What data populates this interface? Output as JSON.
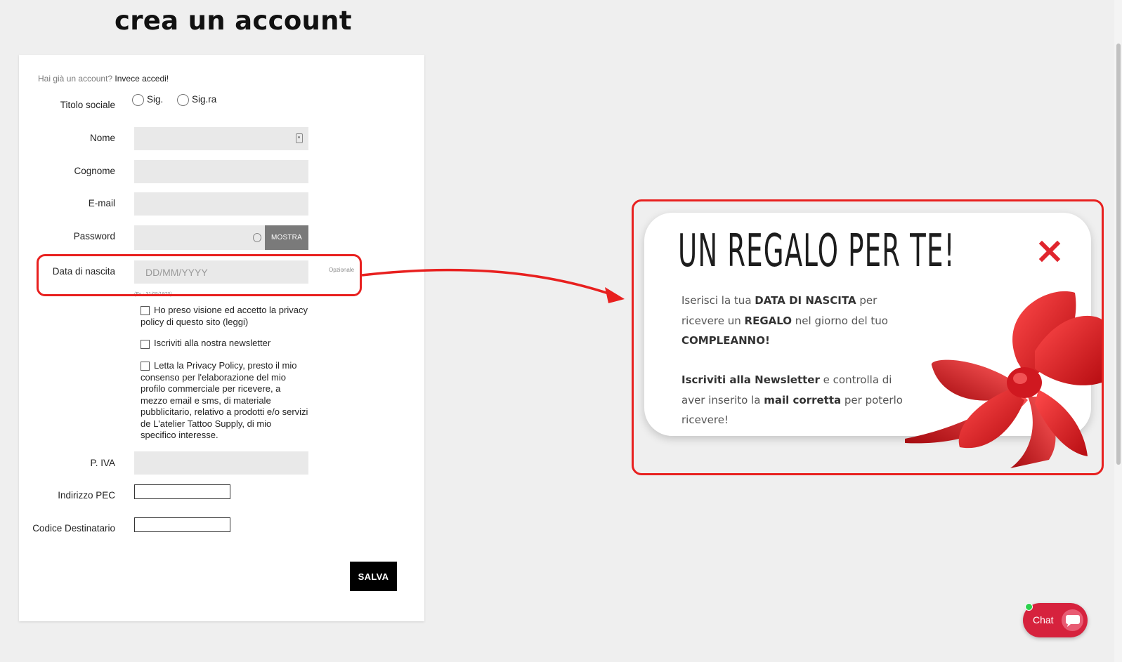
{
  "page": {
    "title": "crea un account"
  },
  "form": {
    "login_prompt": "Hai già un account?",
    "login_link": "Invece accedi!",
    "social_title_label": "Titolo sociale",
    "radio_options": [
      "Sig.",
      "Sig.ra"
    ],
    "first_name_label": "Nome",
    "last_name_label": "Cognome",
    "email_label": "E-mail",
    "password_label": "Password",
    "show_password": "MOSTRA",
    "birthdate_label": "Data di nascita",
    "birthdate_placeholder": "DD/MM/YYYY",
    "birthdate_example": "(Es.: 31/05/1970)",
    "optional_tag": "Opzionale",
    "checkboxes": [
      "Ho preso visione ed accetto la privacy policy di questo sito (leggi)",
      "Iscriviti alla nostra newsletter",
      "Letta la Privacy Policy, presto il mio consenso per l'elaborazione del mio profilo commerciale per ricevere, a mezzo email e sms, di materiale pubblicitario, relativo a prodotti e/o servizi de L'atelier Tattoo Supply, di mio specifico interesse."
    ],
    "vat_label": "P. IVA",
    "pec_label": "Indirizzo PEC",
    "recipient_code_label": "Codice Destinatario",
    "save_button": "SALVA"
  },
  "popup": {
    "title": "UN REGALO PER TE!",
    "p1_a": "Iserisci la tua ",
    "p1_b": "DATA DI NASCITA",
    "p1_c": " per ricevere un ",
    "p1_d": "REGALO",
    "p1_e": " nel giorno del tuo ",
    "p1_f": "COMPLEANNO!",
    "p2_a": "Iscriviti alla Newsletter",
    "p2_b": " e controlla di aver inserito la ",
    "p2_c": "mail corretta",
    "p2_d": " per poterlo ricevere!"
  },
  "chat": {
    "label": "Chat"
  },
  "colors": {
    "highlight": "#e8201f",
    "chat": "#d6223d",
    "online": "#2bd14d"
  }
}
